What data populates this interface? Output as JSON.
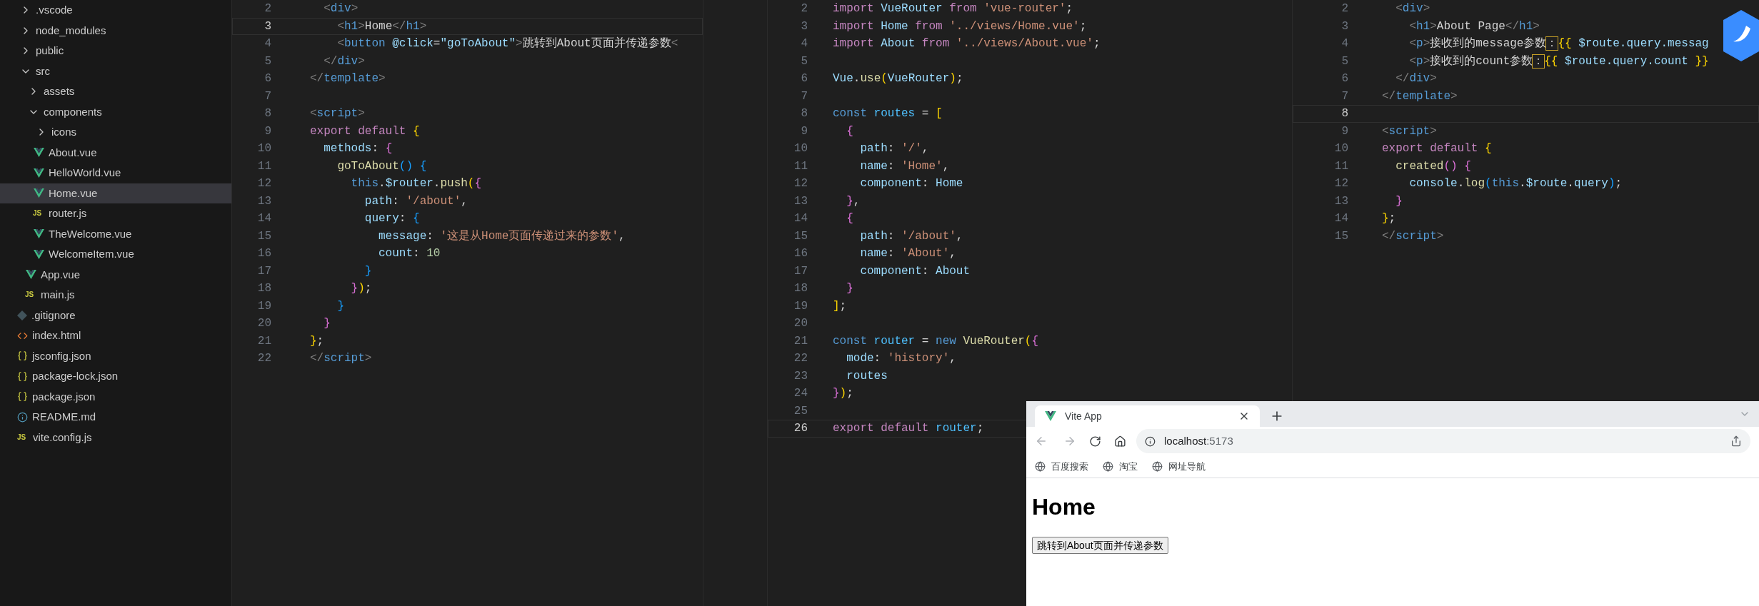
{
  "explorer": {
    "items": [
      {
        "kind": "folder",
        "label": ".vscode",
        "expanded": false,
        "selected": false
      },
      {
        "kind": "folder",
        "label": "node_modules",
        "expanded": false,
        "selected": false
      },
      {
        "kind": "folder",
        "label": "public",
        "expanded": false,
        "selected": false
      },
      {
        "kind": "folder",
        "label": "src",
        "expanded": true,
        "selected": false,
        "children": [
          {
            "kind": "folder",
            "label": "assets",
            "expanded": false,
            "selected": false
          },
          {
            "kind": "folder",
            "label": "components",
            "expanded": true,
            "selected": false,
            "children": [
              {
                "kind": "folder",
                "label": "icons",
                "expanded": false,
                "selected": false
              },
              {
                "kind": "vue",
                "label": "About.vue",
                "selected": false
              },
              {
                "kind": "vue",
                "label": "HelloWorld.vue",
                "selected": false
              },
              {
                "kind": "vue",
                "label": "Home.vue",
                "selected": true
              },
              {
                "kind": "js",
                "badge": "JS",
                "label": "router.js",
                "selected": false
              },
              {
                "kind": "vue",
                "label": "TheWelcome.vue",
                "selected": false
              },
              {
                "kind": "vue",
                "label": "WelcomeItem.vue",
                "selected": false
              }
            ]
          },
          {
            "kind": "vue",
            "label": "App.vue",
            "selected": false
          },
          {
            "kind": "js",
            "badge": "JS",
            "label": "main.js",
            "selected": false
          }
        ]
      },
      {
        "kind": "git",
        "label": ".gitignore",
        "selected": false
      },
      {
        "kind": "html",
        "label": "index.html",
        "selected": false
      },
      {
        "kind": "json",
        "label": "jsconfig.json",
        "selected": false
      },
      {
        "kind": "json",
        "label": "package-lock.json",
        "selected": false
      },
      {
        "kind": "json",
        "label": "package.json",
        "selected": false
      },
      {
        "kind": "info",
        "label": "README.md",
        "selected": false
      },
      {
        "kind": "js",
        "badge": "JS",
        "label": "vite.config.js",
        "selected": false
      }
    ]
  },
  "editors": [
    {
      "lines": [
        {
          "num": "2",
          "current": false,
          "tokens": [
            {
              "kind": "punct",
              "text": "  <"
            },
            {
              "kind": "tag",
              "text": "div"
            },
            {
              "kind": "punct",
              "text": ">"
            }
          ]
        },
        {
          "num": "3",
          "current": true,
          "tokens": [
            {
              "kind": "punct",
              "text": "    <"
            },
            {
              "kind": "tag",
              "text": "h1"
            },
            {
              "kind": "punct",
              "text": ">"
            },
            {
              "kind": "text",
              "text": "Home"
            },
            {
              "kind": "punct",
              "text": "</"
            },
            {
              "kind": "tag",
              "text": "h1"
            },
            {
              "kind": "punct",
              "text": ">"
            }
          ]
        },
        {
          "num": "4",
          "current": false,
          "tokens": [
            {
              "kind": "punct",
              "text": "    <"
            },
            {
              "kind": "tag",
              "text": "button"
            },
            {
              "kind": "prop",
              "text": " @click"
            },
            {
              "kind": "text",
              "text": "="
            },
            {
              "kind": "prop",
              "text": "\"goToAbout\""
            },
            {
              "kind": "punct",
              "text": ">"
            },
            {
              "kind": "text",
              "text": "跳转到About页面并传递参数"
            },
            {
              "kind": "punct",
              "text": "<"
            }
          ]
        },
        {
          "num": "5",
          "current": false,
          "tokens": [
            {
              "kind": "punct",
              "text": "  </"
            },
            {
              "kind": "tag",
              "text": "div"
            },
            {
              "kind": "punct",
              "text": ">"
            }
          ]
        },
        {
          "num": "6",
          "current": false,
          "tokens": [
            {
              "kind": "punct",
              "text": "</"
            },
            {
              "kind": "tag",
              "text": "template"
            },
            {
              "kind": "punct",
              "text": ">"
            }
          ]
        },
        {
          "num": "7",
          "current": false
        },
        {
          "num": "8",
          "current": false,
          "tokens": [
            {
              "kind": "punct",
              "text": "<"
            },
            {
              "kind": "tag",
              "text": "script"
            },
            {
              "kind": "punct",
              "text": ">"
            }
          ]
        },
        {
          "num": "9",
          "current": false,
          "tokens": [
            {
              "kind": "keyword",
              "text": "export default "
            },
            {
              "kind": "b1",
              "text": "{"
            }
          ]
        },
        {
          "num": "10",
          "current": false,
          "tokens": [
            {
              "kind": "prop",
              "text": "  methods"
            },
            {
              "kind": "text",
              "text": ": "
            },
            {
              "kind": "b2",
              "text": "{"
            }
          ]
        },
        {
          "num": "11",
          "current": false,
          "tokens": [
            {
              "kind": "func",
              "text": "    goToAbout"
            },
            {
              "kind": "b3",
              "text": "() {"
            }
          ]
        },
        {
          "num": "12",
          "current": false,
          "tokens": [
            {
              "kind": "tag",
              "text": "      this"
            },
            {
              "kind": "text",
              "text": "."
            },
            {
              "kind": "prop",
              "text": "$router"
            },
            {
              "kind": "text",
              "text": "."
            },
            {
              "kind": "func",
              "text": "push"
            },
            {
              "kind": "b1",
              "text": "("
            },
            {
              "kind": "b2",
              "text": "{"
            }
          ]
        },
        {
          "num": "13",
          "current": false,
          "tokens": [
            {
              "kind": "prop",
              "text": "        path"
            },
            {
              "kind": "text",
              "text": ": "
            },
            {
              "kind": "string",
              "text": "'/about'"
            },
            {
              "kind": "text",
              "text": ","
            }
          ]
        },
        {
          "num": "14",
          "current": false,
          "tokens": [
            {
              "kind": "prop",
              "text": "        query"
            },
            {
              "kind": "text",
              "text": ": "
            },
            {
              "kind": "b3",
              "text": "{"
            }
          ]
        },
        {
          "num": "15",
          "current": false,
          "tokens": [
            {
              "kind": "prop",
              "text": "          message"
            },
            {
              "kind": "text",
              "text": ": "
            },
            {
              "kind": "string",
              "text": "'这是从Home页面传递过来的参数'"
            },
            {
              "kind": "text",
              "text": ","
            }
          ]
        },
        {
          "num": "16",
          "current": false,
          "tokens": [
            {
              "kind": "prop",
              "text": "          count"
            },
            {
              "kind": "text",
              "text": ": "
            },
            {
              "kind": "number",
              "text": "10"
            }
          ]
        },
        {
          "num": "17",
          "current": false,
          "tokens": [
            {
              "kind": "b3",
              "text": "        }"
            }
          ]
        },
        {
          "num": "18",
          "current": false,
          "tokens": [
            {
              "kind": "b2",
              "text": "      }"
            },
            {
              "kind": "b1",
              "text": ")"
            },
            {
              "kind": "text",
              "text": ";"
            }
          ]
        },
        {
          "num": "19",
          "current": false,
          "tokens": [
            {
              "kind": "b3",
              "text": "    }"
            }
          ]
        },
        {
          "num": "20",
          "current": false,
          "tokens": [
            {
              "kind": "b2",
              "text": "  }"
            }
          ]
        },
        {
          "num": "21",
          "current": false,
          "tokens": [
            {
              "kind": "b1",
              "text": "}"
            },
            {
              "kind": "text",
              "text": ";"
            }
          ]
        },
        {
          "num": "22",
          "current": false,
          "tokens": [
            {
              "kind": "punct",
              "text": "</"
            },
            {
              "kind": "tag",
              "text": "script"
            },
            {
              "kind": "punct",
              "text": ">"
            }
          ]
        }
      ]
    },
    {
      "lines": [
        {
          "num": "2",
          "current": false,
          "tokens": [
            {
              "kind": "keyword",
              "text": "import "
            },
            {
              "kind": "prop",
              "text": "VueRouter"
            },
            {
              "kind": "keyword",
              "text": " from "
            },
            {
              "kind": "string",
              "text": "'vue-router'"
            },
            {
              "kind": "text",
              "text": ";"
            }
          ]
        },
        {
          "num": "3",
          "current": false,
          "tokens": [
            {
              "kind": "keyword",
              "text": "import "
            },
            {
              "kind": "prop",
              "text": "Home"
            },
            {
              "kind": "keyword",
              "text": " from "
            },
            {
              "kind": "string",
              "text": "'../views/Home.vue'"
            },
            {
              "kind": "text",
              "text": ";"
            }
          ]
        },
        {
          "num": "4",
          "current": false,
          "tokens": [
            {
              "kind": "keyword",
              "text": "import "
            },
            {
              "kind": "prop",
              "text": "About"
            },
            {
              "kind": "keyword",
              "text": " from "
            },
            {
              "kind": "string",
              "text": "'../views/About.vue'"
            },
            {
              "kind": "text",
              "text": ";"
            }
          ]
        },
        {
          "num": "5",
          "current": false
        },
        {
          "num": "6",
          "current": false,
          "tokens": [
            {
              "kind": "prop",
              "text": "Vue"
            },
            {
              "kind": "text",
              "text": "."
            },
            {
              "kind": "func",
              "text": "use"
            },
            {
              "kind": "b1",
              "text": "("
            },
            {
              "kind": "prop",
              "text": "VueRouter"
            },
            {
              "kind": "b1",
              "text": ")"
            },
            {
              "kind": "text",
              "text": ";"
            }
          ]
        },
        {
          "num": "7",
          "current": false
        },
        {
          "num": "8",
          "current": false,
          "tokens": [
            {
              "kind": "tag",
              "text": "const "
            },
            {
              "kind": "var",
              "text": "routes"
            },
            {
              "kind": "text",
              "text": " = "
            },
            {
              "kind": "b1",
              "text": "["
            }
          ]
        },
        {
          "num": "9",
          "current": false,
          "tokens": [
            {
              "kind": "b2",
              "text": "  {"
            }
          ]
        },
        {
          "num": "10",
          "current": false,
          "tokens": [
            {
              "kind": "prop",
              "text": "    path"
            },
            {
              "kind": "text",
              "text": ": "
            },
            {
              "kind": "string",
              "text": "'/'"
            },
            {
              "kind": "text",
              "text": ","
            }
          ]
        },
        {
          "num": "11",
          "current": false,
          "tokens": [
            {
              "kind": "prop",
              "text": "    name"
            },
            {
              "kind": "text",
              "text": ": "
            },
            {
              "kind": "string",
              "text": "'Home'"
            },
            {
              "kind": "text",
              "text": ","
            }
          ]
        },
        {
          "num": "12",
          "current": false,
          "tokens": [
            {
              "kind": "prop",
              "text": "    component"
            },
            {
              "kind": "text",
              "text": ": "
            },
            {
              "kind": "prop",
              "text": "Home"
            }
          ]
        },
        {
          "num": "13",
          "current": false,
          "tokens": [
            {
              "kind": "b2",
              "text": "  }"
            },
            {
              "kind": "text",
              "text": ","
            }
          ]
        },
        {
          "num": "14",
          "current": false,
          "tokens": [
            {
              "kind": "b2",
              "text": "  {"
            }
          ]
        },
        {
          "num": "15",
          "current": false,
          "tokens": [
            {
              "kind": "prop",
              "text": "    path"
            },
            {
              "kind": "text",
              "text": ": "
            },
            {
              "kind": "string",
              "text": "'/about'"
            },
            {
              "kind": "text",
              "text": ","
            }
          ]
        },
        {
          "num": "16",
          "current": false,
          "tokens": [
            {
              "kind": "prop",
              "text": "    name"
            },
            {
              "kind": "text",
              "text": ": "
            },
            {
              "kind": "string",
              "text": "'About'"
            },
            {
              "kind": "text",
              "text": ","
            }
          ]
        },
        {
          "num": "17",
          "current": false,
          "tokens": [
            {
              "kind": "prop",
              "text": "    component"
            },
            {
              "kind": "text",
              "text": ": "
            },
            {
              "kind": "prop",
              "text": "About"
            }
          ]
        },
        {
          "num": "18",
          "current": false,
          "tokens": [
            {
              "kind": "b2",
              "text": "  }"
            }
          ]
        },
        {
          "num": "19",
          "current": false,
          "tokens": [
            {
              "kind": "b1",
              "text": "]"
            },
            {
              "kind": "text",
              "text": ";"
            }
          ]
        },
        {
          "num": "20",
          "current": false
        },
        {
          "num": "21",
          "current": false,
          "tokens": [
            {
              "kind": "tag",
              "text": "const "
            },
            {
              "kind": "var",
              "text": "router"
            },
            {
              "kind": "text",
              "text": " = "
            },
            {
              "kind": "tag",
              "text": "new "
            },
            {
              "kind": "func",
              "text": "VueRouter"
            },
            {
              "kind": "b1",
              "text": "("
            },
            {
              "kind": "b2",
              "text": "{"
            }
          ]
        },
        {
          "num": "22",
          "current": false,
          "tokens": [
            {
              "kind": "prop",
              "text": "  mode"
            },
            {
              "kind": "text",
              "text": ": "
            },
            {
              "kind": "string",
              "text": "'history'"
            },
            {
              "kind": "text",
              "text": ","
            }
          ]
        },
        {
          "num": "23",
          "current": false,
          "tokens": [
            {
              "kind": "prop",
              "text": "  routes"
            }
          ]
        },
        {
          "num": "24",
          "current": false,
          "tokens": [
            {
              "kind": "b2",
              "text": "}"
            },
            {
              "kind": "b1",
              "text": ")"
            },
            {
              "kind": "text",
              "text": ";"
            }
          ]
        },
        {
          "num": "25",
          "current": false
        },
        {
          "num": "26",
          "current": true,
          "tokens": [
            {
              "kind": "keyword",
              "text": "export default "
            },
            {
              "kind": "var",
              "text": "router"
            },
            {
              "kind": "text",
              "text": ";"
            }
          ]
        }
      ]
    },
    {
      "lines": [
        {
          "num": "2",
          "current": false,
          "tokens": [
            {
              "kind": "punct",
              "text": "  <"
            },
            {
              "kind": "tag",
              "text": "div"
            },
            {
              "kind": "punct",
              "text": ">"
            }
          ]
        },
        {
          "num": "3",
          "current": false,
          "tokens": [
            {
              "kind": "punct",
              "text": "    <"
            },
            {
              "kind": "tag",
              "text": "h1"
            },
            {
              "kind": "punct",
              "text": ">"
            },
            {
              "kind": "text",
              "text": "About Page"
            },
            {
              "kind": "punct",
              "text": "</"
            },
            {
              "kind": "tag",
              "text": "h1"
            },
            {
              "kind": "punct",
              "text": ">"
            }
          ]
        },
        {
          "num": "4",
          "current": false,
          "tokens": [
            {
              "kind": "punct",
              "text": "    <"
            },
            {
              "kind": "tag",
              "text": "p"
            },
            {
              "kind": "punct",
              "text": ">"
            },
            {
              "kind": "text",
              "text": "接收到的message参数"
            },
            {
              "kind": "warn",
              "text": "："
            },
            {
              "kind": "b1",
              "text": "{{"
            },
            {
              "kind": "prop",
              "text": " $route.query.messag"
            }
          ]
        },
        {
          "num": "5",
          "current": false,
          "tokens": [
            {
              "kind": "punct",
              "text": "    <"
            },
            {
              "kind": "tag",
              "text": "p"
            },
            {
              "kind": "punct",
              "text": ">"
            },
            {
              "kind": "text",
              "text": "接收到的count参数"
            },
            {
              "kind": "warn",
              "text": "："
            },
            {
              "kind": "b1",
              "text": "{{"
            },
            {
              "kind": "prop",
              "text": " $route.query.count "
            },
            {
              "kind": "b1",
              "text": "}}"
            }
          ]
        },
        {
          "num": "6",
          "current": false,
          "tokens": [
            {
              "kind": "punct",
              "text": "  </"
            },
            {
              "kind": "tag",
              "text": "div"
            },
            {
              "kind": "punct",
              "text": ">"
            }
          ]
        },
        {
          "num": "7",
          "current": false,
          "tokens": [
            {
              "kind": "punct",
              "text": "</"
            },
            {
              "kind": "tag",
              "text": "template"
            },
            {
              "kind": "punct",
              "text": ">"
            }
          ]
        },
        {
          "num": "8",
          "current": true
        },
        {
          "num": "9",
          "current": false,
          "tokens": [
            {
              "kind": "punct",
              "text": "<"
            },
            {
              "kind": "tag",
              "text": "script"
            },
            {
              "kind": "punct",
              "text": ">"
            }
          ]
        },
        {
          "num": "10",
          "current": false,
          "tokens": [
            {
              "kind": "keyword",
              "text": "export default "
            },
            {
              "kind": "b1",
              "text": "{"
            }
          ]
        },
        {
          "num": "11",
          "current": false,
          "tokens": [
            {
              "kind": "func",
              "text": "  created"
            },
            {
              "kind": "b2",
              "text": "() {"
            }
          ]
        },
        {
          "num": "12",
          "current": false,
          "tokens": [
            {
              "kind": "prop",
              "text": "    console"
            },
            {
              "kind": "text",
              "text": "."
            },
            {
              "kind": "func",
              "text": "log"
            },
            {
              "kind": "b3",
              "text": "("
            },
            {
              "kind": "tag",
              "text": "this"
            },
            {
              "kind": "text",
              "text": "."
            },
            {
              "kind": "prop",
              "text": "$route"
            },
            {
              "kind": "text",
              "text": "."
            },
            {
              "kind": "prop",
              "text": "query"
            },
            {
              "kind": "b3",
              "text": ")"
            },
            {
              "kind": "text",
              "text": ";"
            }
          ]
        },
        {
          "num": "13",
          "current": false,
          "tokens": [
            {
              "kind": "b2",
              "text": "  }"
            }
          ]
        },
        {
          "num": "14",
          "current": false,
          "tokens": [
            {
              "kind": "b1",
              "text": "}"
            },
            {
              "kind": "text",
              "text": ";"
            }
          ]
        },
        {
          "num": "15",
          "current": false,
          "tokens": [
            {
              "kind": "punct",
              "text": "</"
            },
            {
              "kind": "tag",
              "text": "script"
            },
            {
              "kind": "punct",
              "text": ">"
            }
          ]
        }
      ]
    }
  ],
  "browser": {
    "tab": {
      "title": "Vite App"
    },
    "url": {
      "host": "localhost",
      "port": ":5173"
    },
    "bookmarks": [
      "百度搜索",
      "淘宝",
      "网址导航"
    ],
    "page": {
      "heading": "Home",
      "button": "跳转到About页面并传递参数"
    }
  }
}
